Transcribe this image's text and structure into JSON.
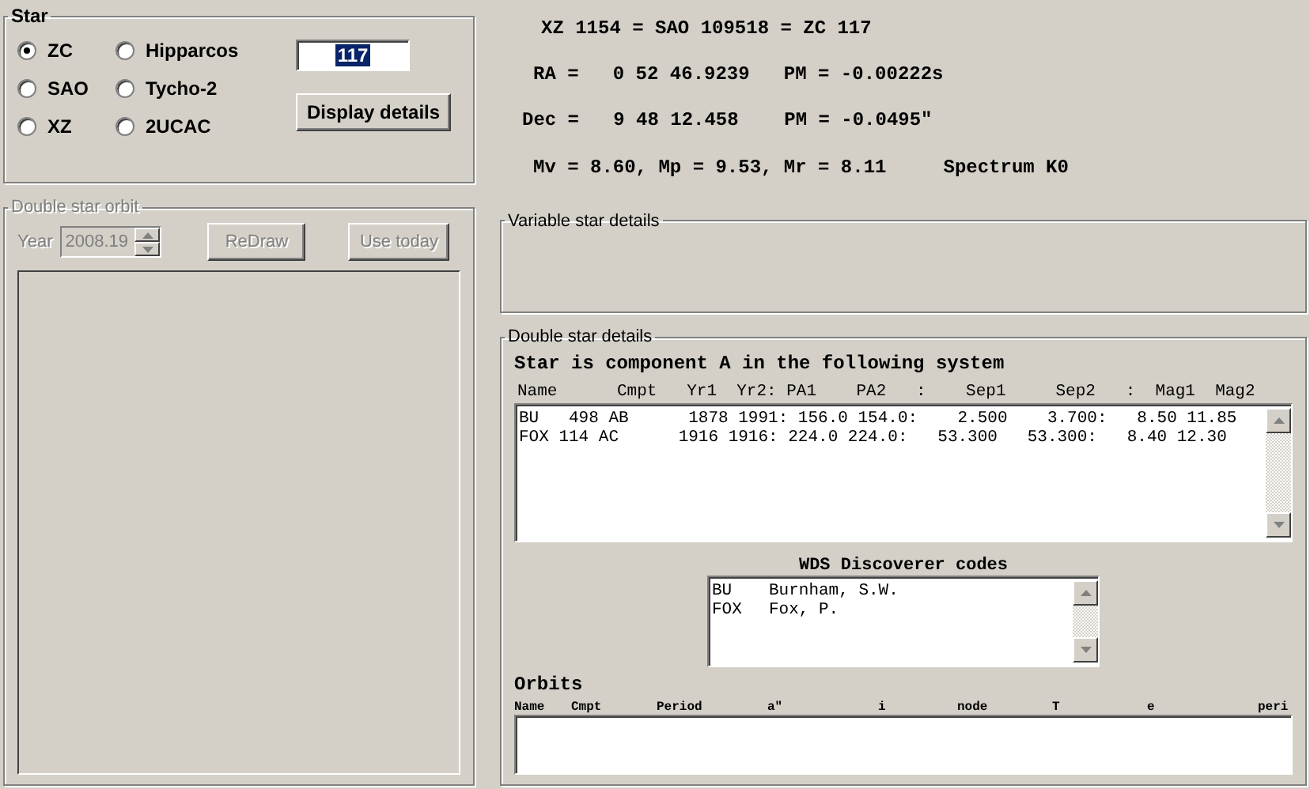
{
  "star": {
    "title": "Star",
    "catalogs": [
      {
        "label": "ZC",
        "selected": true
      },
      {
        "label": "Hipparcos",
        "selected": false
      },
      {
        "label": "SAO",
        "selected": false
      },
      {
        "label": "Tycho-2",
        "selected": false
      },
      {
        "label": "XZ",
        "selected": false
      },
      {
        "label": "2UCAC",
        "selected": false
      }
    ],
    "number": "117",
    "button": "Display details"
  },
  "orbit": {
    "title": "Double star orbit",
    "disabled": true,
    "year_label": "Year",
    "year": "2008.19",
    "buttons": [
      "ReDraw",
      "Use today"
    ]
  },
  "info": [
    "XZ 1154 = SAO 109518 = ZC 117",
    "RA =   0 52 46.9239   PM = -0.00222s",
    "Dec =   9 48 12.458    PM = -0.0495\"",
    "Mv = 8.60, Mp = 9.53, Mr = 8.11     Spectrum K0"
  ],
  "variable": {
    "title": "Variable star details"
  },
  "double": {
    "title": "Double star details",
    "heading": "Star is component A in the following system",
    "columns": "Name      Cmpt   Yr1  Yr2: PA1    PA2   :    Sep1     Sep2   :  Mag1  Mag2",
    "rows": [
      "BU   498 AB      1878 1991: 156.0 154.0:    2.500    3.700:   8.50 11.85",
      "FOX 114 AC      1916 1916: 224.0 224.0:   53.300   53.300:   8.40 12.30"
    ],
    "codes_title": "WDS Discoverer codes",
    "codes": [
      {
        "code": "BU",
        "name": "Burnham, S.W."
      },
      {
        "code": "FOX",
        "name": "Fox, P."
      }
    ],
    "orbits_title": "Orbits",
    "orbit_columns": [
      "Name",
      "Cmpt",
      "Period",
      "a\"",
      "i",
      "node",
      "T",
      "e",
      "peri"
    ]
  }
}
